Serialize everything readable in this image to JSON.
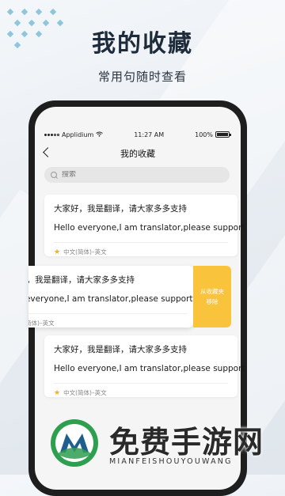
{
  "hero": {
    "title": "我的收藏",
    "subtitle": "常用句随时查看"
  },
  "status_bar": {
    "carrier": "Applidium",
    "time": "11:27 AM",
    "battery": "100%",
    "battery_level": 1.0
  },
  "nav": {
    "title": "我的收藏"
  },
  "search": {
    "placeholder": "搜索"
  },
  "cards": [
    {
      "zh": "大家好，我是翻译，请大家多多支持",
      "en": "Hello everyone,I am translator,please support",
      "lang": "中文(简体)–英文"
    },
    {
      "zh": "大家好，我是翻译，请大家多多支持",
      "en": "Hello everyone,I am translator,please support",
      "lang": "中文(简体)–英文",
      "action_line1": "从收藏夹",
      "action_line2": "移除"
    },
    {
      "zh": "大家好，我是翻译，请大家多多支持",
      "en": "Hello everyone,I am translator,please support",
      "lang": "中文(简体)–英文"
    }
  ],
  "watermark": {
    "cn": "免费手游网",
    "en": "MIANFEISHOUYOUWANG"
  },
  "colors": {
    "accent_yellow": "#f9c33b",
    "star": "#f4b400",
    "logo_green": "#2e9e4f",
    "logo_blue": "#1f5f8f"
  }
}
